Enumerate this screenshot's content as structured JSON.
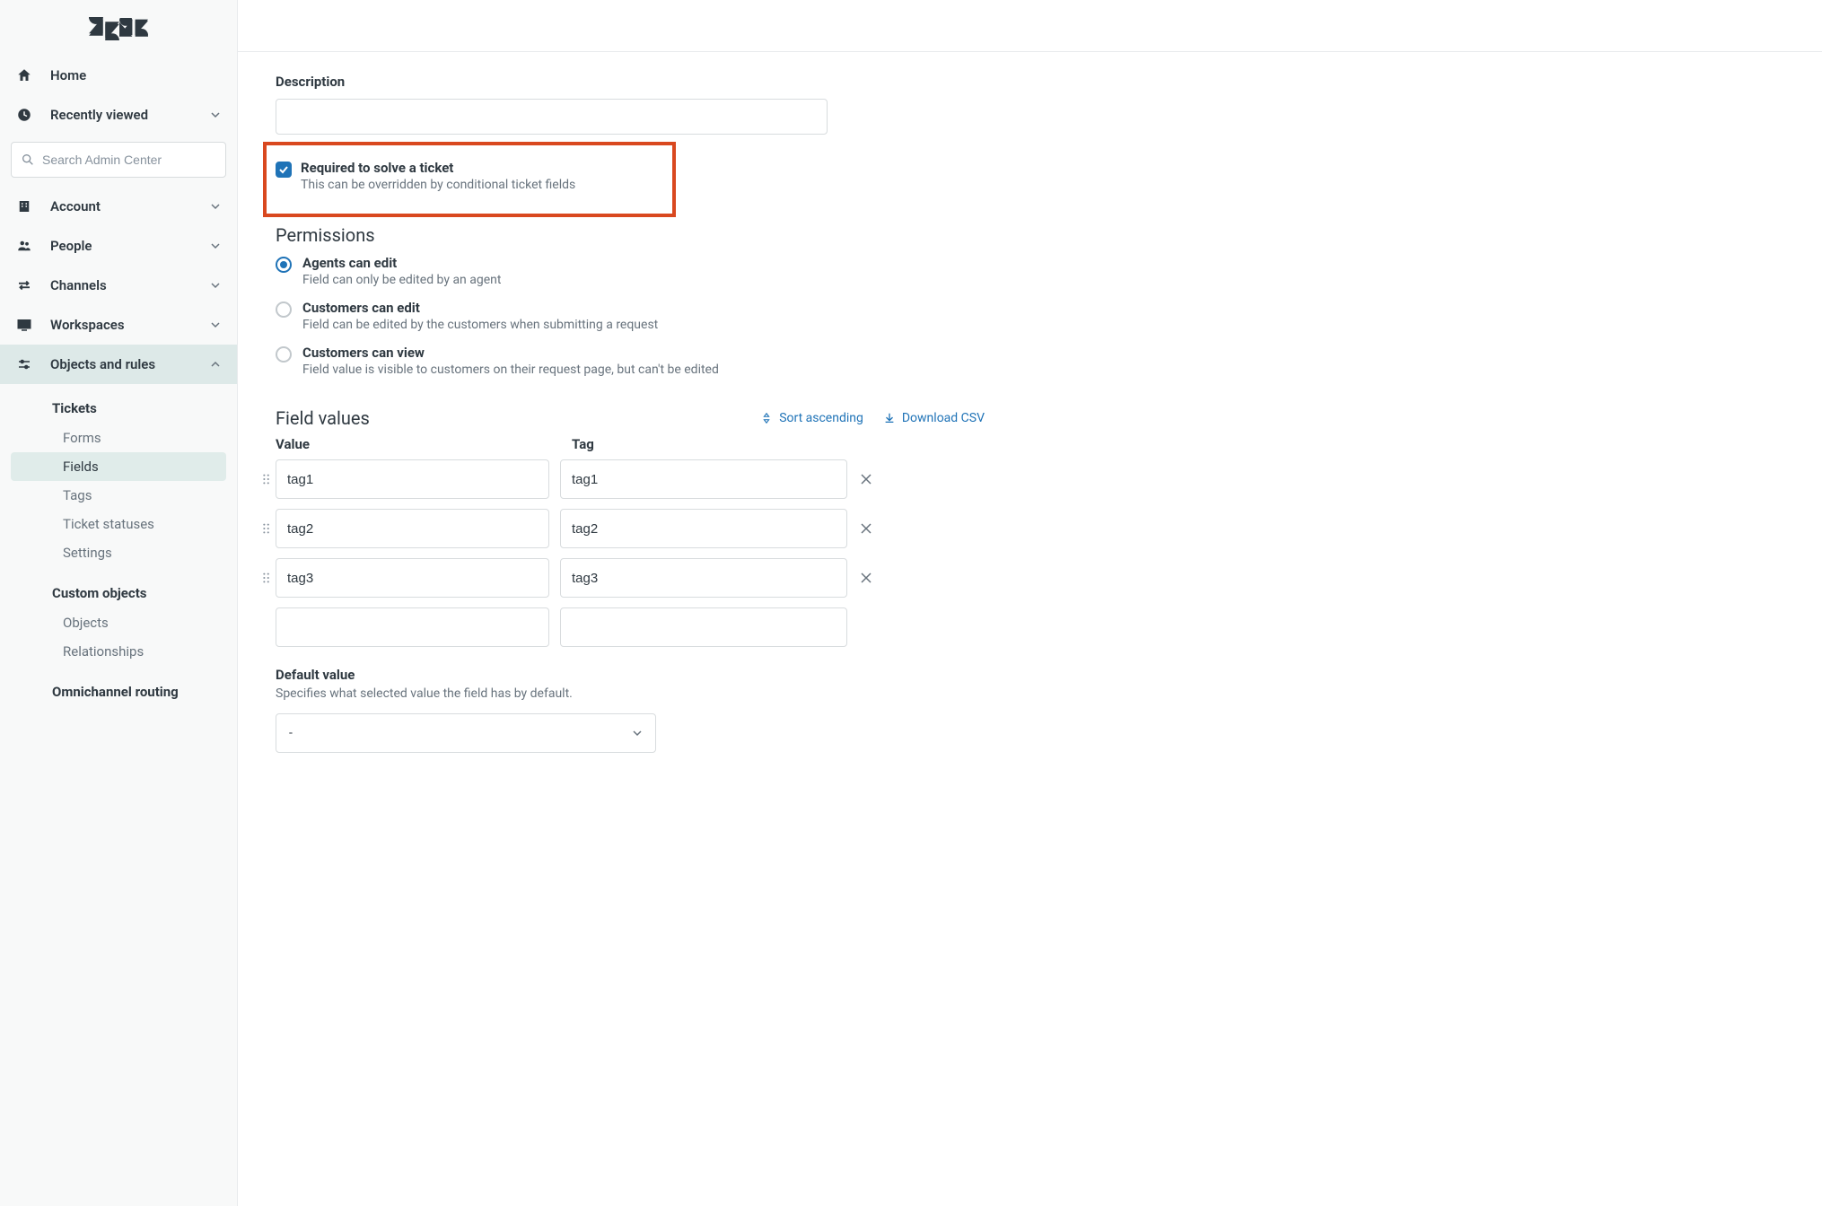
{
  "sidebar": {
    "home": "Home",
    "recently_viewed": "Recently viewed",
    "search_placeholder": "Search Admin Center",
    "account": "Account",
    "people": "People",
    "channels": "Channels",
    "workspaces": "Workspaces",
    "objects_rules": "Objects and rules",
    "sub": {
      "tickets_heading": "Tickets",
      "forms": "Forms",
      "fields": "Fields",
      "tags": "Tags",
      "ticket_statuses": "Ticket statuses",
      "settings": "Settings",
      "custom_objects_heading": "Custom objects",
      "objects": "Objects",
      "relationships": "Relationships",
      "omnichannel_heading": "Omnichannel routing"
    }
  },
  "form": {
    "description_label": "Description",
    "description_value": "",
    "required": {
      "title": "Required to solve a ticket",
      "sub": "This can be overridden by conditional ticket fields"
    },
    "permissions": {
      "title": "Permissions",
      "agents_edit": {
        "title": "Agents can edit",
        "sub": "Field can only be edited by an agent"
      },
      "customers_edit": {
        "title": "Customers can edit",
        "sub": "Field can be edited by the customers when submitting a request"
      },
      "customers_view": {
        "title": "Customers can view",
        "sub": "Field value is visible to customers on their request page, but can't be edited"
      }
    },
    "field_values": {
      "title": "Field values",
      "sort_asc": "Sort ascending",
      "download_csv": "Download CSV",
      "col_value": "Value",
      "col_tag": "Tag",
      "rows": [
        {
          "value": "tag1",
          "tag": "tag1"
        },
        {
          "value": "tag2",
          "tag": "tag2"
        },
        {
          "value": "tag3",
          "tag": "tag3"
        }
      ]
    },
    "default_value": {
      "title": "Default value",
      "sub": "Specifies what selected value the field has by default.",
      "selected": "-"
    }
  }
}
